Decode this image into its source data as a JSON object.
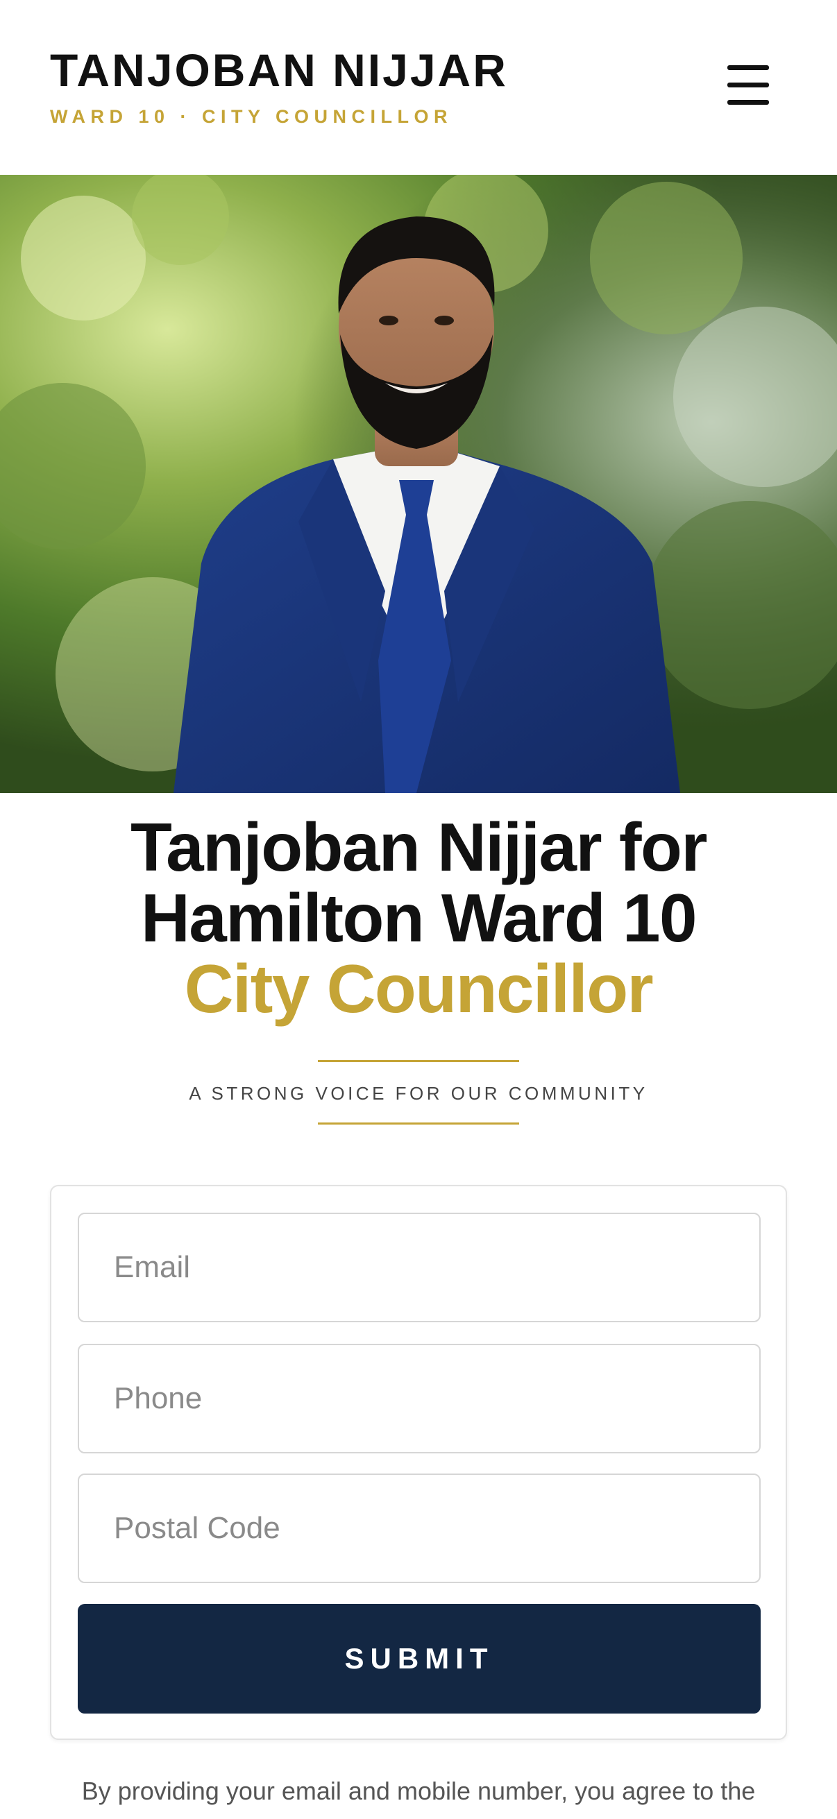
{
  "header": {
    "name": "TANJOBAN NIJJAR",
    "subtitle": "WARD 10 · CITY COUNCILLOR",
    "menu_icon": "hamburger-menu-icon"
  },
  "hero": {
    "photo": "candidate-portrait"
  },
  "headline": {
    "line1": "Tanjoban Nijjar for",
    "line2": "Hamilton Ward 10",
    "line3": "City Councillor"
  },
  "tagline": "A STRONG VOICE FOR OUR COMMUNITY",
  "form": {
    "email_placeholder": "Email",
    "phone_placeholder": "Phone",
    "postal_placeholder": "Postal Code",
    "submit_label": "SUBMIT"
  },
  "consent_text": "By providing your email and mobile number, you agree to the",
  "colors": {
    "accent_gold": "#c5a436",
    "navy": "#132743",
    "text_dark": "#111111"
  }
}
